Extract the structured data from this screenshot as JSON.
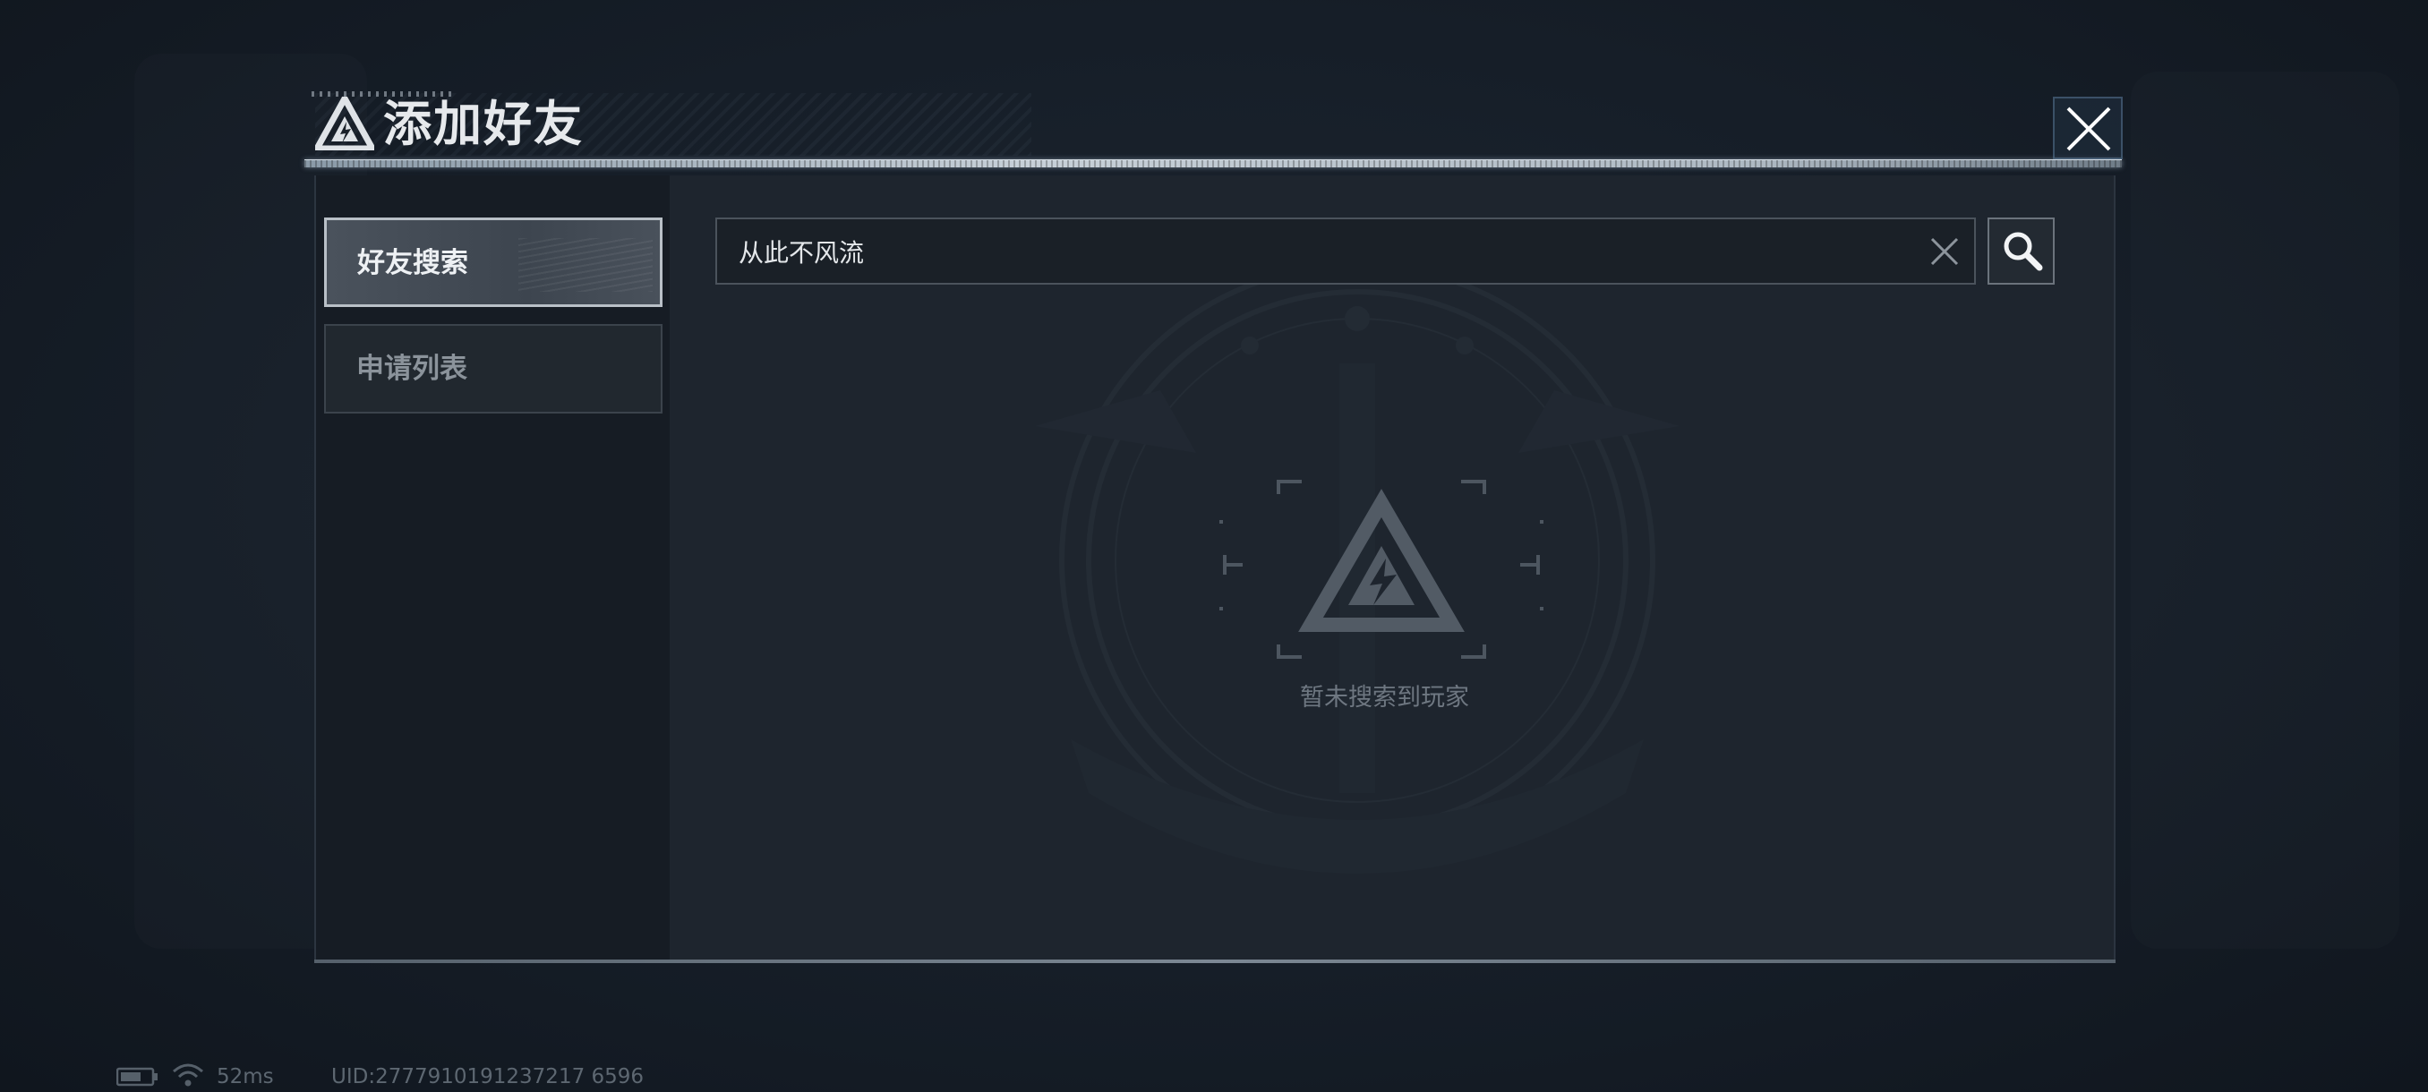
{
  "dialog": {
    "title": "添加好友",
    "close_icon": "close-icon",
    "title_icon": "game-logo-icon"
  },
  "sidebar": {
    "tabs": [
      {
        "label": "好友搜索",
        "selected": true
      },
      {
        "label": "申请列表",
        "selected": false
      }
    ]
  },
  "search": {
    "value": "从此不风流",
    "placeholder": "",
    "clear_icon": "clear-icon",
    "button_icon": "search-icon"
  },
  "empty_state": {
    "icon": "game-logo-icon",
    "message": "暂未搜索到玩家"
  },
  "status_bar": {
    "battery_icon": "battery-icon",
    "wifi_icon": "wifi-icon",
    "ping": "52ms",
    "uid": "UID:2777910191237217 6596"
  },
  "colors": {
    "background": "#141c25",
    "panel": "#1e252e",
    "sidebar": "#161c24",
    "selected_tab": "#454d57",
    "text_primary": "#e6e9ec",
    "text_muted": "#6e7781"
  }
}
